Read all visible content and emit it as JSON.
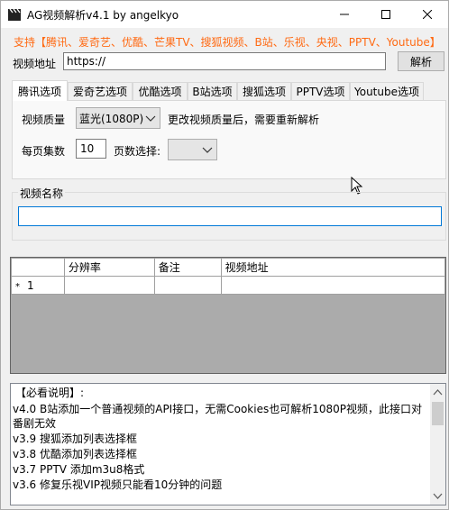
{
  "window": {
    "title": "AG视频解析v4.1 by angelkyo"
  },
  "support_text": "支持【腾讯、爱奇艺、优酷、芒果TV、搜狐视频、B站、乐视、央视、PPTV、Youtube】",
  "url": {
    "label": "视频地址",
    "value": "https://",
    "parse_button": "解析"
  },
  "tabs": [
    {
      "label": "腾讯选项",
      "active": true
    },
    {
      "label": "爱奇艺选项"
    },
    {
      "label": "优酷选项"
    },
    {
      "label": "B站选项"
    },
    {
      "label": "搜狐选项"
    },
    {
      "label": "PPTV选项"
    },
    {
      "label": "Youtube选项"
    }
  ],
  "tencent": {
    "quality_label": "视频质量",
    "quality_value": "蓝光(1080P)",
    "quality_hint": "更改视频质量后，需要重新解析",
    "per_page_label": "每页集数",
    "per_page_value": "10",
    "page_select_label": "页数选择:",
    "page_select_value": ""
  },
  "video_name": {
    "label": "视频名称",
    "value": ""
  },
  "grid": {
    "columns": [
      "分辨率",
      "备注",
      "视频地址"
    ],
    "rows": [
      {
        "marker": "*",
        "num": "1",
        "cells": [
          "",
          "",
          ""
        ]
      }
    ]
  },
  "notes": {
    "lines": [
      "【必看说明】:",
      "  v4.0 B站添加一个普通视频的API接口，无需Cookies也可解析1080P视频，此接口对",
      "番剧无效",
      "  v3.9 搜狐添加列表选择框",
      "  v3.8 优酷添加列表选择框",
      "  v3.7 PPTV 添加m3u8格式",
      "  v3.6 修复乐视VIP视频只能看10分钟的问题"
    ]
  },
  "colors": {
    "support_text": "#ff6a13",
    "focus_border": "#0078d7",
    "grid_background": "#ababab"
  }
}
